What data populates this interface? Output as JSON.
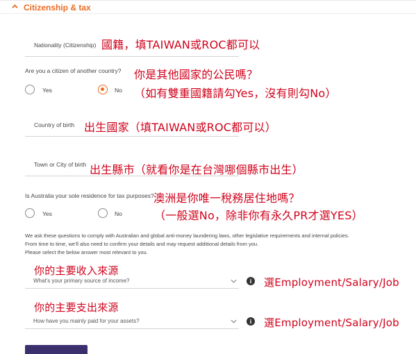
{
  "section": {
    "title": "Citizenship & tax",
    "icon": "chevron-up-icon"
  },
  "nationality": {
    "label": "Nationality (Citizenship)",
    "note": "國籍，填TAIWAN或ROC都可以"
  },
  "other_citizen": {
    "question": "Are you a citizen of another country?",
    "note1": "你是其他國家的公民嗎？",
    "note2": "（如有雙重國籍請勾Yes，沒有則勾No）",
    "options": [
      {
        "label": "Yes",
        "selected": false
      },
      {
        "label": "No",
        "selected": true
      }
    ]
  },
  "country_of_birth": {
    "label": "Country of birth",
    "note": "出生國家（填TAIWAN或ROC都可以）"
  },
  "town_of_birth": {
    "label": "Town or City of birth",
    "note": "出生縣市（就看你是在台灣哪個縣市出生）"
  },
  "tax_residence": {
    "question": "Is Australia your sole residence for tax purposes?",
    "note1": "澳洲是你唯一稅務居住地嗎？",
    "note2": "（一般選No，除非你有永久PR才選YES）",
    "options": [
      {
        "label": "Yes",
        "selected": false
      },
      {
        "label": "No",
        "selected": false
      }
    ]
  },
  "compliance": {
    "line1": "We ask these questions to comply with Australian and global anti-money laundering laws, other legislative requirements and internal policies.",
    "line2": "From time to time, we'll also need to confirm your details and may request additional details from you.",
    "line3": "Please select the below answer most relevant to you."
  },
  "income_source": {
    "note": "你的主要收入來源",
    "placeholder": "What's your primary source of income?",
    "hint": "選Employment/Salary/Job"
  },
  "asset_payment": {
    "note": "你的主要支出來源",
    "placeholder": "How have you mainly paid for your assets?",
    "hint": "選Employment/Salary/Job"
  },
  "colors": {
    "accent": "#ec6a1e",
    "annotation": "#d0021b",
    "button": "#3b2f6e"
  }
}
